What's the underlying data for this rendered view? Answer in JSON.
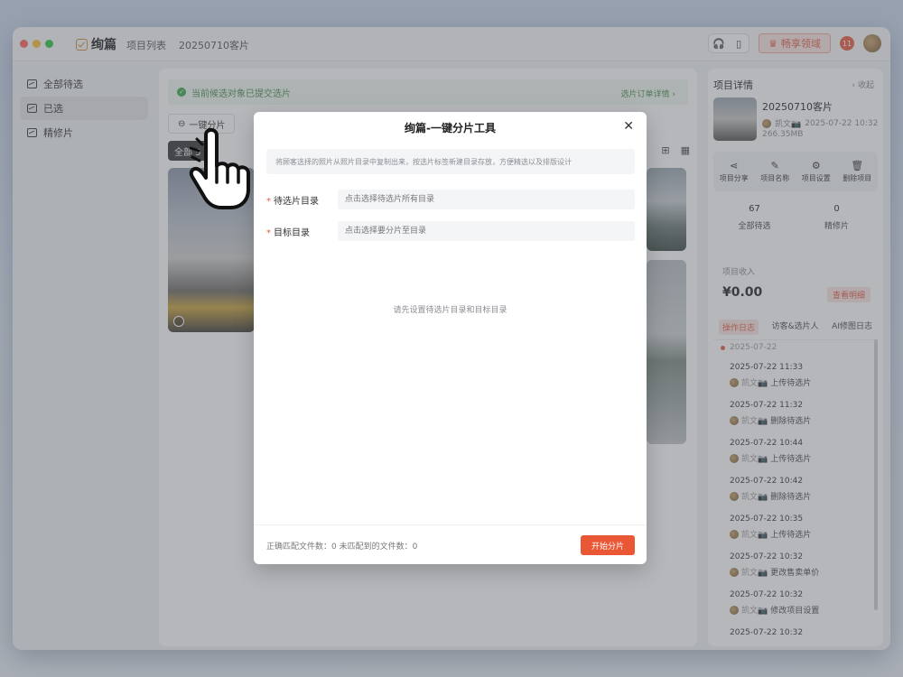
{
  "titlebar": {
    "brand": "绚篇",
    "crumbs": [
      "项目列表",
      "20250710客片"
    ],
    "upgrade_btn": "畅享领域",
    "badge": "11"
  },
  "nav": {
    "items": [
      {
        "label": "全部待选",
        "active": false
      },
      {
        "label": "已选",
        "active": true
      },
      {
        "label": "精修片",
        "active": false
      }
    ]
  },
  "main": {
    "banner": "当前候选对象已提交选片",
    "banner_link": "选片订单详情 ›",
    "split_btn": "一键分片",
    "tab_all": "全部 5"
  },
  "right": {
    "head": "项目详情",
    "collapse": "› 收起",
    "title": "20250710客片",
    "owner": "凯文📷",
    "date": "2025-07-22 10:32",
    "size": "266.35MB",
    "actions": [
      {
        "icon": "share-icon",
        "glyph": "⋖",
        "label": "项目分享"
      },
      {
        "icon": "edit-icon",
        "glyph": "✎",
        "label": "项目名称"
      },
      {
        "icon": "gear-icon",
        "glyph": "⚙",
        "label": "项目设置"
      },
      {
        "icon": "trash-icon",
        "glyph": "🗑",
        "label": "删除项目"
      }
    ],
    "stats": [
      {
        "n": "67",
        "label": "全部待选"
      },
      {
        "n": "0",
        "label": "精修片"
      }
    ],
    "income_label": "项目收入",
    "income": "¥0.00",
    "income_detail": "查看明细",
    "tabs": [
      "操作日志",
      "访客&选片人",
      "AI修图日志"
    ],
    "log_date": "2025-07-22",
    "logs": [
      {
        "time": "2025-07-22 11:33",
        "user": "凯文📷",
        "action": "上传待选片"
      },
      {
        "time": "2025-07-22 11:32",
        "user": "凯文📷",
        "action": "删除待选片"
      },
      {
        "time": "2025-07-22 10:44",
        "user": "凯文📷",
        "action": "上传待选片"
      },
      {
        "time": "2025-07-22 10:42",
        "user": "凯文📷",
        "action": "删除待选片"
      },
      {
        "time": "2025-07-22 10:35",
        "user": "凯文📷",
        "action": "上传待选片"
      },
      {
        "time": "2025-07-22 10:32",
        "user": "凯文📷",
        "action": "更改售卖单价"
      },
      {
        "time": "2025-07-22 10:32",
        "user": "凯文📷",
        "action": "修改项目设置"
      },
      {
        "time": "2025-07-22 10:32",
        "user": "",
        "action": ""
      }
    ]
  },
  "modal": {
    "title": "绚篇-一键分片工具",
    "desc": "将顾客选择的照片从照片目录中复制出来，按选片标签新建目录存放，方便精选以及排版设计",
    "field1_label": "待选片目录",
    "field1_placeholder": "点击选择待选片所有目录",
    "field2_label": "目标目录",
    "field2_placeholder": "点击选择要分片至目录",
    "empty": "请先设置待选片目录和目标目录",
    "foot_stats": "正确匹配文件数：0 未匹配到的文件数：0",
    "start_btn": "开始分片"
  }
}
